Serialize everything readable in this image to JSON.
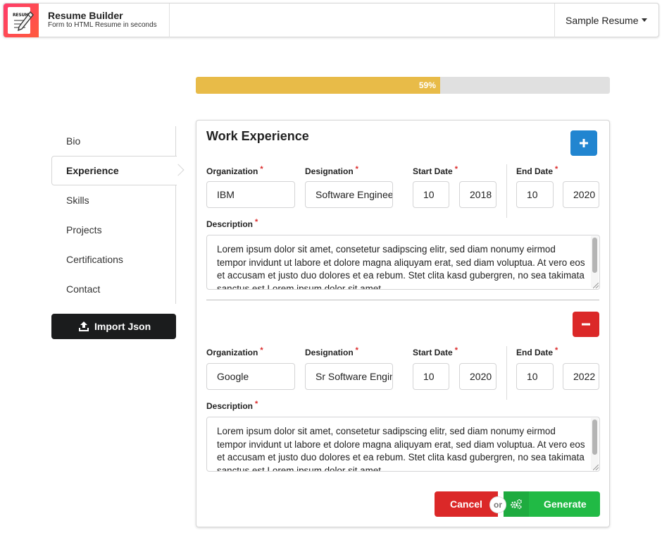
{
  "header": {
    "logo_text": "RESUME",
    "title": "Resume Builder",
    "subtitle": "Form to HTML Resume in seconds",
    "sample_select": "Sample Resume"
  },
  "progress": {
    "percent": 59,
    "label": "59%"
  },
  "sidebar": {
    "items": [
      {
        "label": "Bio",
        "active": false
      },
      {
        "label": "Experience",
        "active": true
      },
      {
        "label": "Skills",
        "active": false
      },
      {
        "label": "Projects",
        "active": false
      },
      {
        "label": "Certifications",
        "active": false
      },
      {
        "label": "Contact",
        "active": false
      }
    ],
    "import_label": "Import Json"
  },
  "form": {
    "title": "Work Experience",
    "labels": {
      "organization": "Organization",
      "designation": "Designation",
      "start_date": "Start Date",
      "end_date": "End Date",
      "description": "Description",
      "required_mark": "*"
    },
    "entries": [
      {
        "organization": "IBM",
        "designation": "Software Engineer",
        "start_month": "10",
        "start_year": "2018",
        "end_month": "10",
        "end_year": "2020",
        "description": "Lorem ipsum dolor sit amet, consetetur sadipscing elitr, sed diam nonumy eirmod tempor invidunt ut labore et dolore magna aliquyam erat, sed diam voluptua. At vero eos et accusam et justo duo dolores et ea rebum. Stet clita kasd gubergren, no sea takimata sanctus est Lorem ipsum dolor sit amet."
      },
      {
        "organization": "Google",
        "designation": "Sr Software Engineer",
        "start_month": "10",
        "start_year": "2020",
        "end_month": "10",
        "end_year": "2022",
        "description": "Lorem ipsum dolor sit amet, consetetur sadipscing elitr, sed diam nonumy eirmod tempor invidunt ut labore et dolore magna aliquyam erat, sed diam voluptua. At vero eos et accusam et justo duo dolores et ea rebum. Stet clita kasd gubergren, no sea takimata sanctus est Lorem ipsum dolor sit amet."
      }
    ],
    "cancel_label": "Cancel",
    "or_label": "or",
    "generate_label": "Generate"
  },
  "colors": {
    "progress": "#e8bb48",
    "add_button": "#2185d0",
    "remove_button": "#db2828",
    "cancel": "#db2828",
    "generate": "#21ba45",
    "import_button": "#1b1c1d"
  },
  "icons": {
    "add": "plus-icon",
    "remove": "minus-icon",
    "import": "upload-icon",
    "generate": "cogs-icon",
    "select": "caret-down-icon"
  }
}
